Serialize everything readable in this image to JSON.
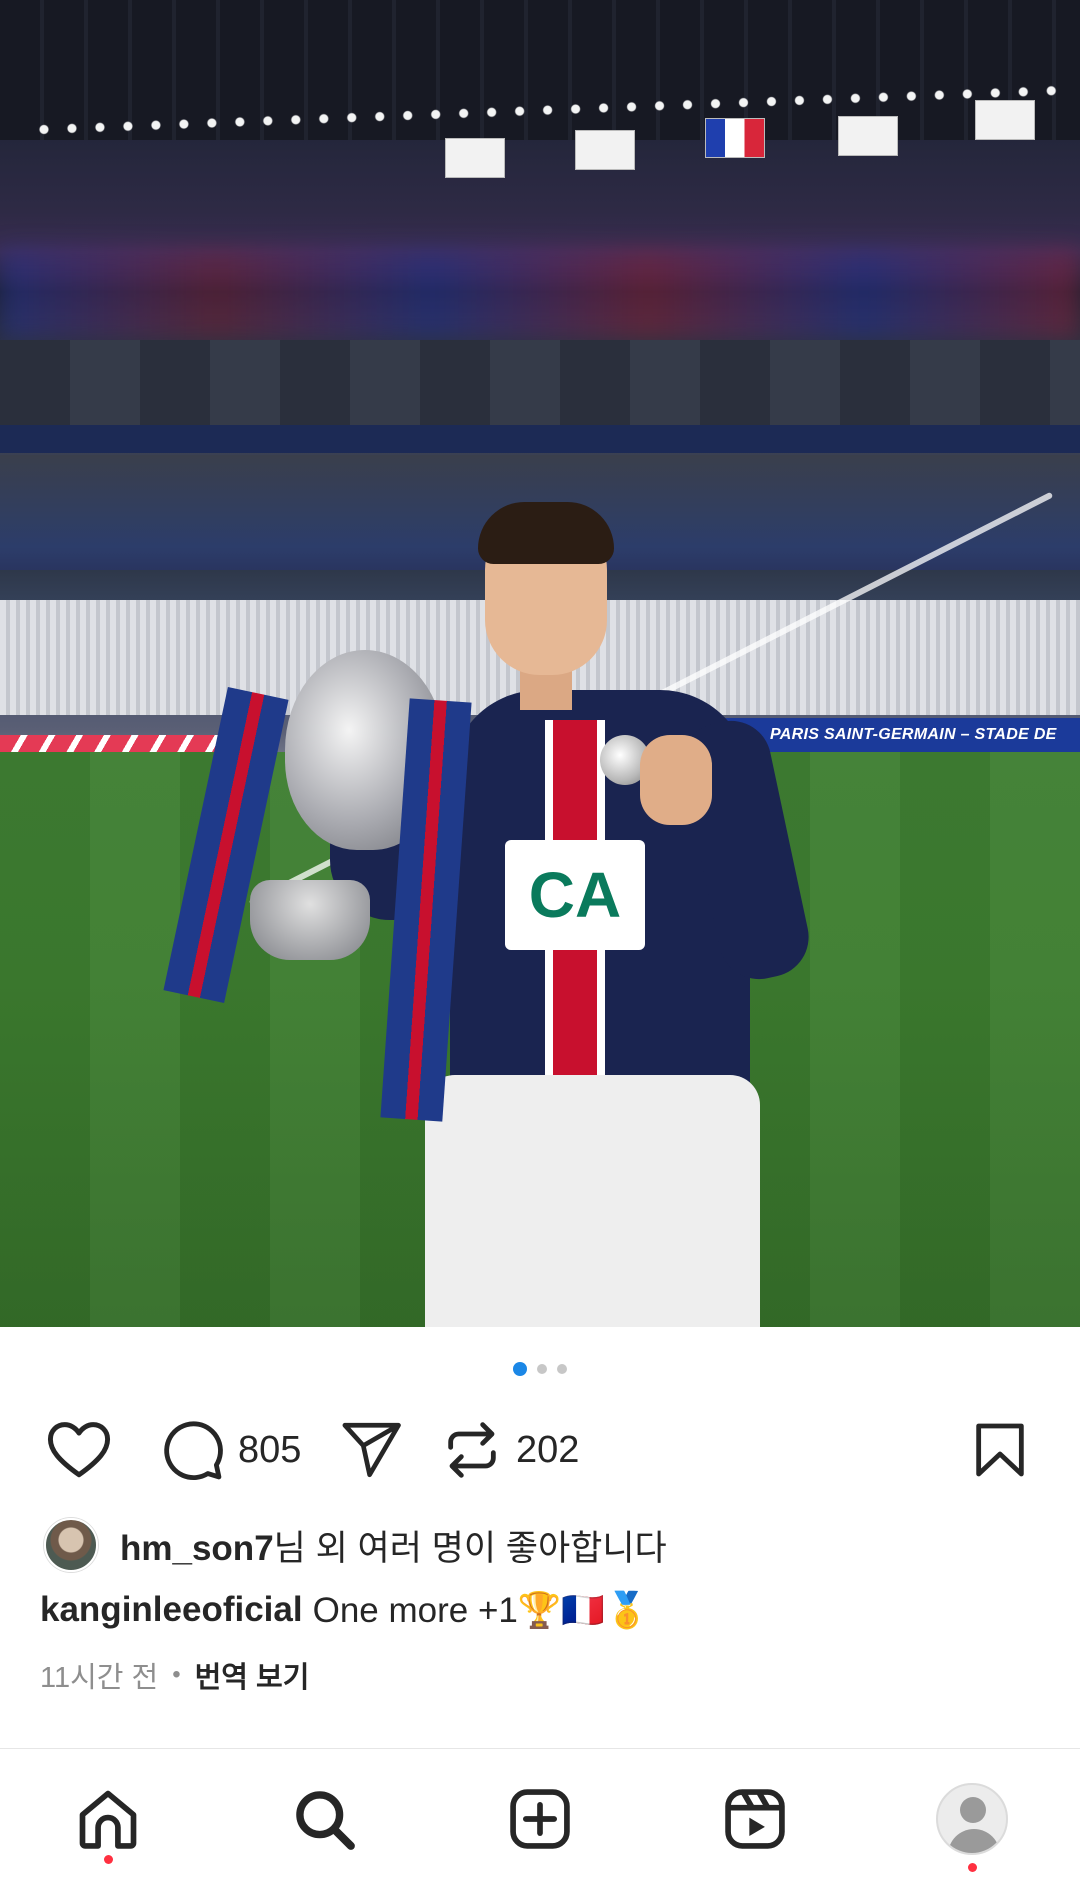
{
  "post": {
    "carousel": {
      "total": 3,
      "active_index": 0
    },
    "photo_signage": {
      "ad_board": "PARIS SAINT-GERMAIN – STADE DE REIMS"
    },
    "actions": {
      "like_icon": "heart-icon",
      "comment_icon": "comment-icon",
      "comment_count": "805",
      "share_icon": "send-icon",
      "repost_icon": "repost-icon",
      "repost_count": "202",
      "save_icon": "bookmark-icon"
    },
    "likes": {
      "liker": "hm_son7",
      "suffix": "님 외 여러 명이 좋아합니다"
    },
    "caption": {
      "username": "kanginleeoficial",
      "text": "One more +1🏆🇫🇷🥇"
    },
    "meta": {
      "time": "11시간 전",
      "separator": "•",
      "translate": "번역 보기"
    }
  },
  "bottom_nav": {
    "items": [
      "home-icon",
      "search-icon",
      "create-icon",
      "reels-icon",
      "profile-avatar"
    ]
  },
  "colors": {
    "accent_blue": "#1b87e6",
    "notification_red": "#ff3040",
    "text": "#262626",
    "muted": "#8e8e8e"
  }
}
